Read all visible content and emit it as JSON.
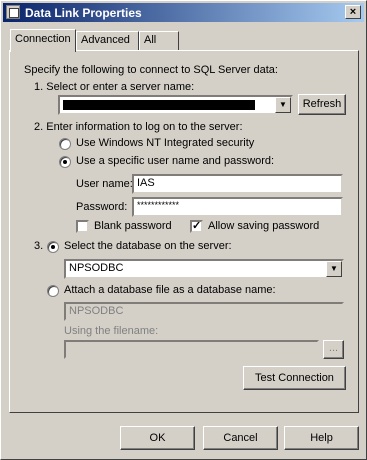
{
  "window": {
    "title": "Data Link Properties",
    "close_label": "×"
  },
  "tabs": [
    {
      "label": "Connection"
    },
    {
      "label": "Advanced"
    },
    {
      "label": "All"
    }
  ],
  "intro": "Specify the following to connect to SQL Server data:",
  "step1": {
    "label": "1. Select or enter a server name:",
    "refresh": "Refresh"
  },
  "step2": {
    "label": "2. Enter information to log on to the server:",
    "option_nt": "Use Windows NT Integrated security",
    "option_specific": "Use a specific user name and password:",
    "user_label": "User name:",
    "user_value": "IAS",
    "password_label": "Password:",
    "password_value": "************",
    "blank_password": "Blank password",
    "allow_saving": "Allow saving password"
  },
  "step3": {
    "prefix": "3.",
    "option_select_db": "Select the database on the server:",
    "database_value": "NPSODBC",
    "option_attach": "Attach a database file as a database name:",
    "attach_value": "NPSODBC",
    "filename_label": "Using the filename:",
    "browse": "...",
    "test_connection": "Test Connection"
  },
  "buttons": {
    "ok": "OK",
    "cancel": "Cancel",
    "help": "Help"
  }
}
